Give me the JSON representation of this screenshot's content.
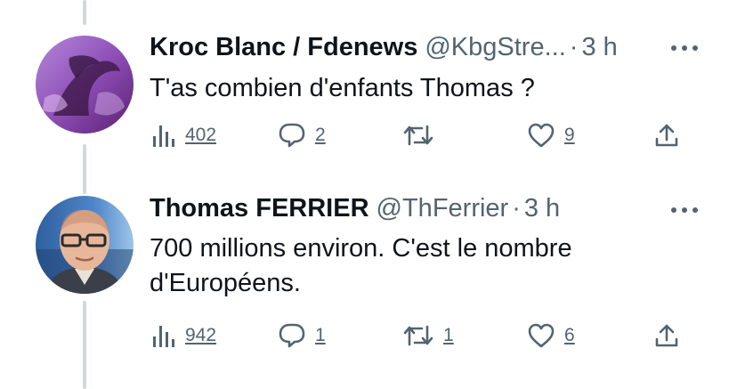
{
  "tweets": [
    {
      "display_name": "Kroc Blanc / Fdenews",
      "handle": "@KbgStre...",
      "separator": "·",
      "time": "3 h",
      "text": "T'as combien d'enfants Thomas ?",
      "views": "402",
      "replies": "2",
      "retweets": "",
      "likes": "9",
      "icons": {
        "views": "views-bar-chart-icon",
        "reply": "reply-bubble-icon",
        "retweet": "retweet-arrows-icon",
        "like": "heart-icon",
        "share": "share-upload-icon",
        "more": "more-dots-icon"
      }
    },
    {
      "display_name": "Thomas FERRIER",
      "handle": "@ThFerrier",
      "separator": "·",
      "time": "3 h",
      "text_line1": "700 millions environ. C'est le nombre",
      "text_line2": "d'Européens.",
      "views": "942",
      "replies": "1",
      "retweets": "1",
      "likes": "6",
      "icons": {
        "views": "views-bar-chart-icon",
        "reply": "reply-bubble-icon",
        "retweet": "retweet-arrows-icon",
        "like": "heart-icon",
        "share": "share-upload-icon",
        "more": "more-dots-icon"
      }
    }
  ],
  "colors": {
    "text": "#0f1419",
    "secondary": "#536471",
    "thread_line": "#cfd9de",
    "background": "#ffffff"
  }
}
